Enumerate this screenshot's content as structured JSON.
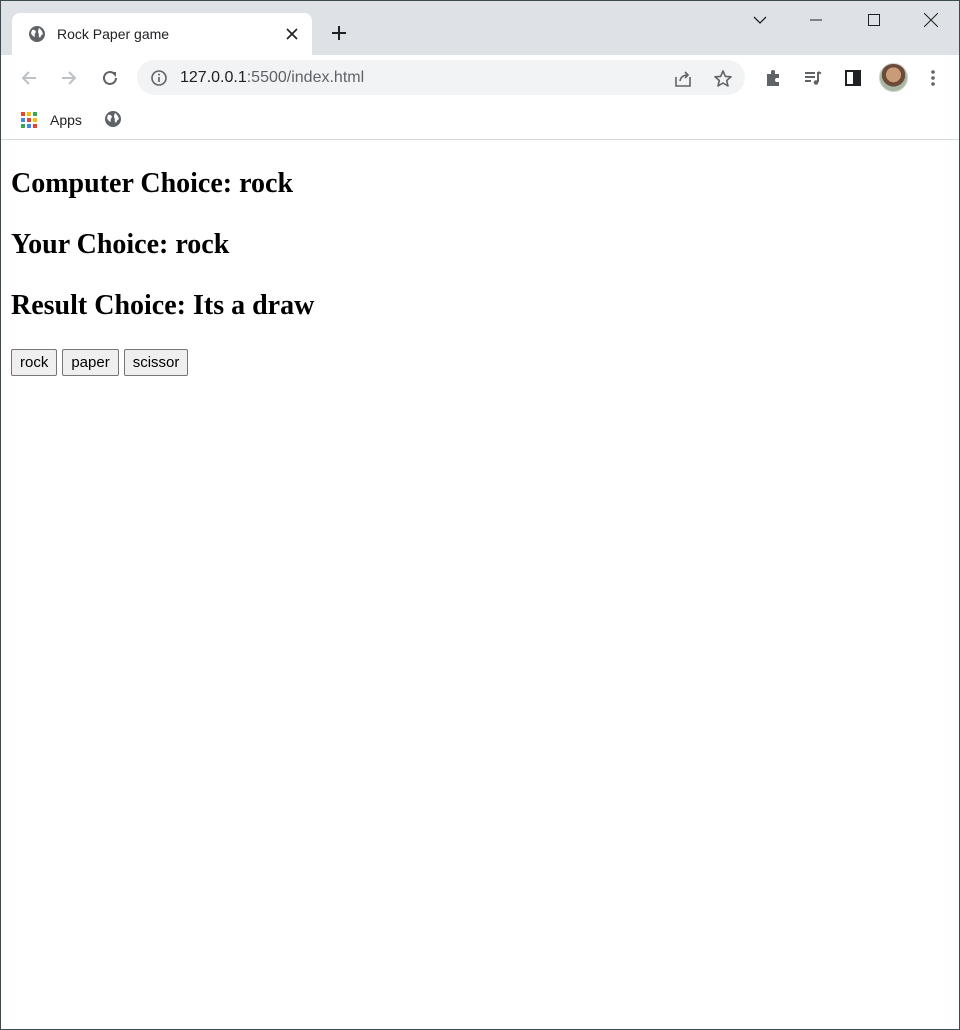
{
  "browser": {
    "tab": {
      "title": "Rock Paper game",
      "favicon": "globe-icon"
    },
    "address_bar": {
      "host": "127.0.0.1",
      "rest": ":5500/index.html"
    },
    "bookmarks": {
      "apps_label": "Apps"
    },
    "colors": {
      "tabstrip": "#dee1e6",
      "omnibox": "#f1f3f4",
      "icon": "#5f6368"
    }
  },
  "page": {
    "computer_choice": "Computer Choice: rock",
    "your_choice": "Your Choice: rock",
    "result_choice": "Result Choice: Its a draw",
    "buttons": {
      "rock": "rock",
      "paper": "paper",
      "scissor": "scissor"
    }
  }
}
